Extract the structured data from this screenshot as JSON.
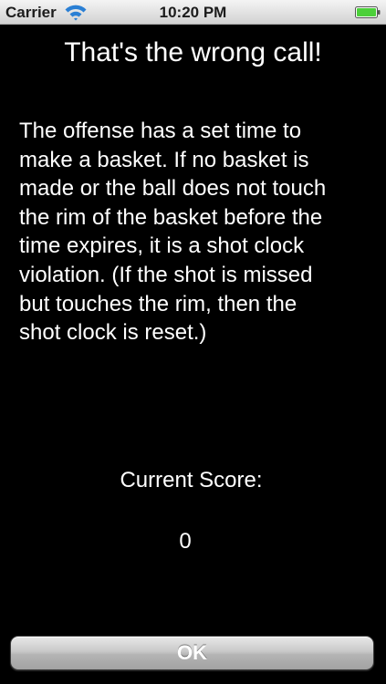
{
  "status_bar": {
    "carrier": "Carrier",
    "time": "10:20 PM",
    "wifi_icon": "wifi-icon",
    "battery_icon": "battery-icon",
    "battery_color": "#4cd03a"
  },
  "screen": {
    "title": "That's the wrong call!",
    "message": "The offense has a set time to\nmake a basket.  If no basket is\nmade or the ball does not touch\nthe rim of the basket before the\ntime expires, it is a shot clock\nviolation.  (If the shot is missed\nbut touches the rim, then the\nshot clock is reset.)",
    "score_label": "Current Score:",
    "score_value": "0"
  },
  "actions": {
    "ok_label": "OK"
  },
  "colors": {
    "background": "#000000",
    "text": "#ffffff"
  }
}
